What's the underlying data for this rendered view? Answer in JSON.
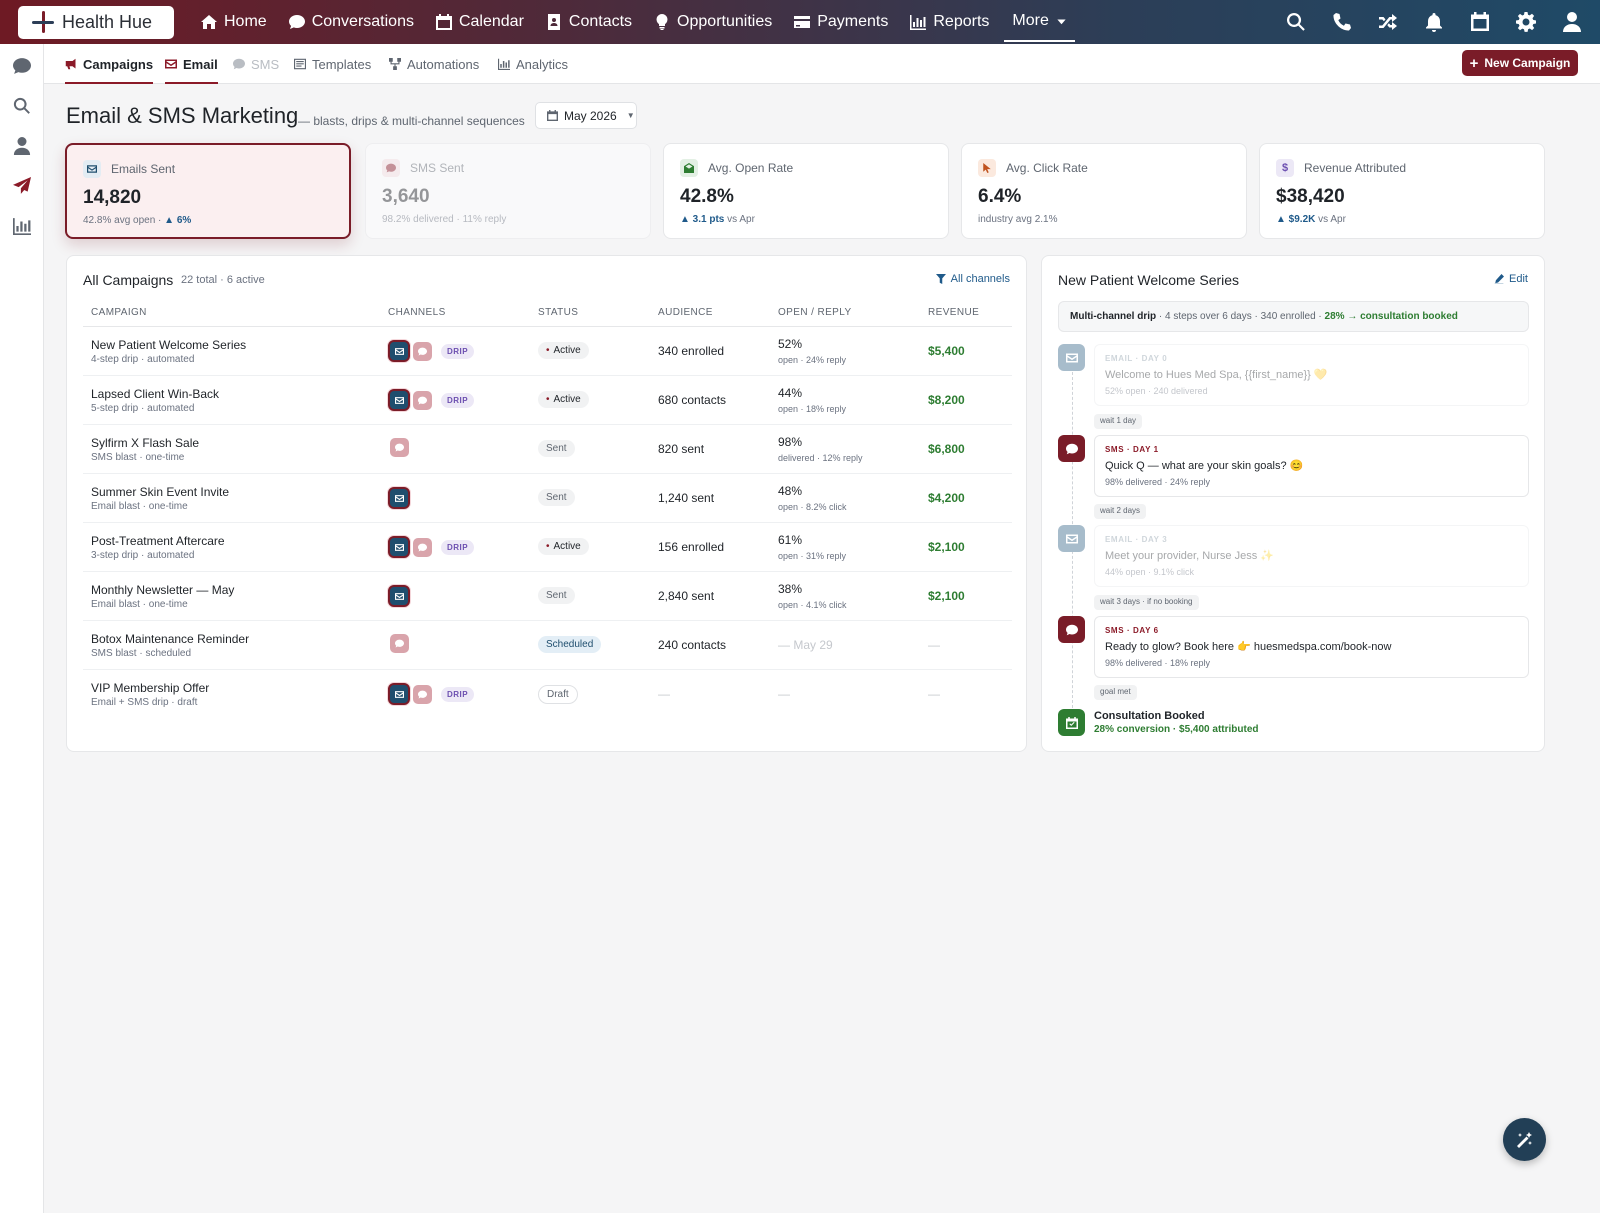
{
  "app": {
    "name": "Health Hue"
  },
  "topnav": {
    "items": [
      {
        "label": "Home",
        "icon": "home-icon"
      },
      {
        "label": "Conversations",
        "icon": "chat-icon"
      },
      {
        "label": "Calendar",
        "icon": "calendar-icon"
      },
      {
        "label": "Contacts",
        "icon": "contact-card-icon"
      },
      {
        "label": "Opportunities",
        "icon": "lightbulb-icon"
      },
      {
        "label": "Payments",
        "icon": "credit-card-icon"
      },
      {
        "label": "Reports",
        "icon": "bar-chart-icon"
      },
      {
        "label": "More",
        "icon": "caret-down-icon"
      }
    ],
    "icons": [
      "search-icon",
      "phone-icon",
      "shuffle-icon",
      "bell-icon",
      "calendar-icon",
      "gear-icon",
      "user-icon"
    ]
  },
  "subnav": {
    "tabs": [
      {
        "label": "Campaigns",
        "icon": "megaphone-icon"
      },
      {
        "label": "Email",
        "icon": "envelope-icon"
      },
      {
        "label": "SMS",
        "icon": "chat-icon"
      },
      {
        "label": "Templates",
        "icon": "template-icon"
      },
      {
        "label": "Automations",
        "icon": "nodes-icon"
      },
      {
        "label": "Analytics",
        "icon": "bar-chart-icon"
      }
    ],
    "new_campaign": "New Campaign"
  },
  "header": {
    "title": "Email & SMS Marketing",
    "subtitle": "— blasts, drips & multi-channel sequences",
    "month": "May 2026"
  },
  "stats": [
    {
      "label": "Emails Sent",
      "value": "14,820",
      "foot_pre": "42.8% avg open · ",
      "foot_bold": "▲ 6%",
      "foot_post": ""
    },
    {
      "label": "SMS Sent",
      "value": "3,640",
      "foot_pre": "98.2% delivered · 11% reply",
      "foot_bold": "",
      "foot_post": ""
    },
    {
      "label": "Avg. Open Rate",
      "value": "42.8%",
      "foot_pre": "",
      "foot_bold": "▲ 3.1 pts",
      "foot_post": " vs Apr"
    },
    {
      "label": "Avg. Click Rate",
      "value": "6.4%",
      "foot_pre": "industry avg 2.1%",
      "foot_bold": "",
      "foot_post": ""
    },
    {
      "label": "Revenue Attributed",
      "value": "$38,420",
      "foot_pre": "",
      "foot_bold": "▲ $9.2K",
      "foot_post": " vs Apr"
    }
  ],
  "campaigns": {
    "title": "All Campaigns",
    "count": "22 total · 6 active",
    "filter": "All channels",
    "columns": [
      "CAMPAIGN",
      "CHANNELS",
      "STATUS",
      "AUDIENCE",
      "OPEN / REPLY",
      "REVENUE"
    ],
    "drip_label": "DRIP",
    "rows": [
      {
        "name": "New Patient Welcome Series",
        "sub": "4-step drip · automated",
        "status": "Active",
        "audience": "340 enrolled",
        "open": "52%",
        "open_sub": "open · 24% reply",
        "revenue": "$5,400"
      },
      {
        "name": "Lapsed Client Win-Back",
        "sub": "5-step drip · automated",
        "status": "Active",
        "audience": "680 contacts",
        "open": "44%",
        "open_sub": "open · 18% reply",
        "revenue": "$8,200"
      },
      {
        "name": "Sylfirm X Flash Sale",
        "sub": "SMS blast · one-time",
        "status": "Sent",
        "audience": "820 sent",
        "open": "98%",
        "open_sub": "delivered · 12% reply",
        "revenue": "$6,800"
      },
      {
        "name": "Summer Skin Event Invite",
        "sub": "Email blast · one-time",
        "status": "Sent",
        "audience": "1,240 sent",
        "open": "48%",
        "open_sub": "open · 8.2% click",
        "revenue": "$4,200"
      },
      {
        "name": "Post-Treatment Aftercare",
        "sub": "3-step drip · automated",
        "status": "Active",
        "audience": "156 enrolled",
        "open": "61%",
        "open_sub": "open · 31% reply",
        "revenue": "$2,100"
      },
      {
        "name": "Monthly Newsletter — May",
        "sub": "Email blast · one-time",
        "status": "Sent",
        "audience": "2,840 sent",
        "open": "38%",
        "open_sub": "open · 4.1% click",
        "revenue": "$2,100"
      },
      {
        "name": "Botox Maintenance Reminder",
        "sub": "SMS blast · scheduled",
        "status": "Scheduled",
        "audience": "240 contacts",
        "open": "— May 29",
        "open_sub": "",
        "revenue": "—"
      },
      {
        "name": "VIP Membership Offer",
        "sub": "Email + SMS drip · draft",
        "status": "Draft",
        "audience": "—",
        "open": "—",
        "open_sub": "",
        "revenue": "—"
      }
    ]
  },
  "series": {
    "title": "New Patient Welcome Series",
    "edit": "Edit",
    "summary_bold": "Multi-channel drip",
    "summary_mid": " · 4 steps over 6 days · 340 enrolled · ",
    "summary_green": "28% → consultation booked",
    "steps": [
      {
        "kicker": "EMAIL · DAY 0",
        "text": "Welcome to Hues Med Spa, {{first_name}} 💛",
        "meta": "52% open · 240 delivered"
      },
      {
        "kicker": "SMS · DAY 1",
        "text": "Quick Q — what are your skin goals? 😊",
        "meta": "98% delivered · 24% reply"
      },
      {
        "kicker": "EMAIL · DAY 3",
        "text": "Meet your provider, Nurse Jess ✨",
        "meta": "44% open · 9.1% click"
      },
      {
        "kicker": "SMS · DAY 6",
        "text": "Ready to glow? Book here 👉 huesmedspa.com/book-now",
        "meta": "98% delivered · 18% reply"
      }
    ],
    "waits": [
      "wait 1 day",
      "wait 2 days",
      "wait 3 days · if no booking",
      "goal met"
    ],
    "goal_title": "Consultation Booked",
    "goal_sub": "28% conversion · $5,400 attributed"
  },
  "colors": {
    "brand": "#7a1c28",
    "navy": "#1f4e6e",
    "success": "#2e7d32"
  }
}
